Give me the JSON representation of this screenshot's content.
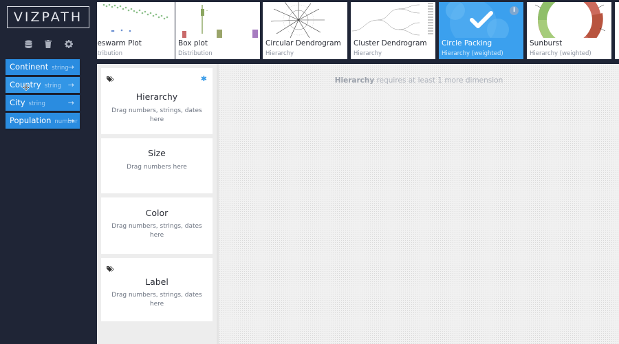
{
  "app": {
    "logo_text": "VIZPATH"
  },
  "toolbar": {
    "icons": [
      "database-icon",
      "trash-icon",
      "gear-icon"
    ]
  },
  "dimensions": [
    {
      "label": "Continent",
      "type": "string"
    },
    {
      "label": "Country",
      "type": "string"
    },
    {
      "label": "City",
      "type": "string"
    },
    {
      "label": "Population",
      "type": "number"
    }
  ],
  "charts": [
    {
      "name": "Beeswarm Plot",
      "name_visible": "eeswarm Plot",
      "category": "Distribution",
      "category_visible": "istribution",
      "selected": false
    },
    {
      "name": "Box plot",
      "category": "Distribution",
      "selected": false
    },
    {
      "name": "Circular Dendrogram",
      "category": "Hierarchy",
      "selected": false
    },
    {
      "name": "Cluster Dendrogram",
      "category": "Hierarchy",
      "selected": false
    },
    {
      "name": "Circle Packing",
      "category": "Hierarchy (weighted)",
      "selected": true
    },
    {
      "name": "Sunburst",
      "category": "Hierarchy (weighted)",
      "selected": false
    }
  ],
  "mapping": {
    "hierarchy": {
      "title": "Hierarchy",
      "hint": "Drag numbers, strings, dates here",
      "required_mark": "✱"
    },
    "size": {
      "title": "Size",
      "hint": "Drag numbers here"
    },
    "color": {
      "title": "Color",
      "hint": "Drag numbers, strings, dates here"
    },
    "label": {
      "title": "Label",
      "hint": "Drag numbers, strings, dates here"
    }
  },
  "message": {
    "highlight": "Hierarchy",
    "text": " requires at least 1 more dimension"
  },
  "colors": {
    "sidebar_bg": "#1f2536",
    "accent": "#2a8ce0",
    "selected_card": "#3ba0ee"
  }
}
